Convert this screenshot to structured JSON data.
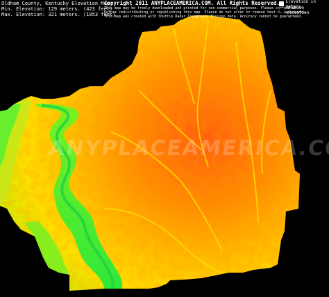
{
  "header": {
    "title": "Oldham County, Kentucky Elevation Map",
    "min_elevation": "Min. Elevation: 129 meters. (423 feet)",
    "max_elevation": "Max. Elevation: 321 meters. (1053 feet)"
  },
  "copyright": {
    "line1": "Copyright 2011 ANYPLACEAMERICA.COM. All Rights Reserved.",
    "line2": "This map may be freely downloaded and printed for non-commercial purposes. Please contact us",
    "line3": "before redistributing or republishing this map. Please do not alter or remove text or watermarks.",
    "line4": "This map was created with Shuttle Radar Topography Mission data. Accuracy cannot be guaranteed."
  },
  "legend": {
    "items": [
      {
        "label": "Elevation in meters.",
        "color": "#ffffff"
      },
      {
        "label": "unknown elevation",
        "color": "#000000"
      }
    ],
    "ramp": [
      "#00ff00",
      "#bfff00",
      "#ffff00",
      "#ffb000",
      "#ff4000"
    ]
  },
  "watermark": "ANYPLACEAMERICA.COM",
  "map_colors": {
    "low": "#3cf23c",
    "mid_low": "#c6e81a",
    "mid": "#ffd400",
    "mid_high": "#ffa000",
    "high": "#ff5a10",
    "background": "#000000"
  }
}
